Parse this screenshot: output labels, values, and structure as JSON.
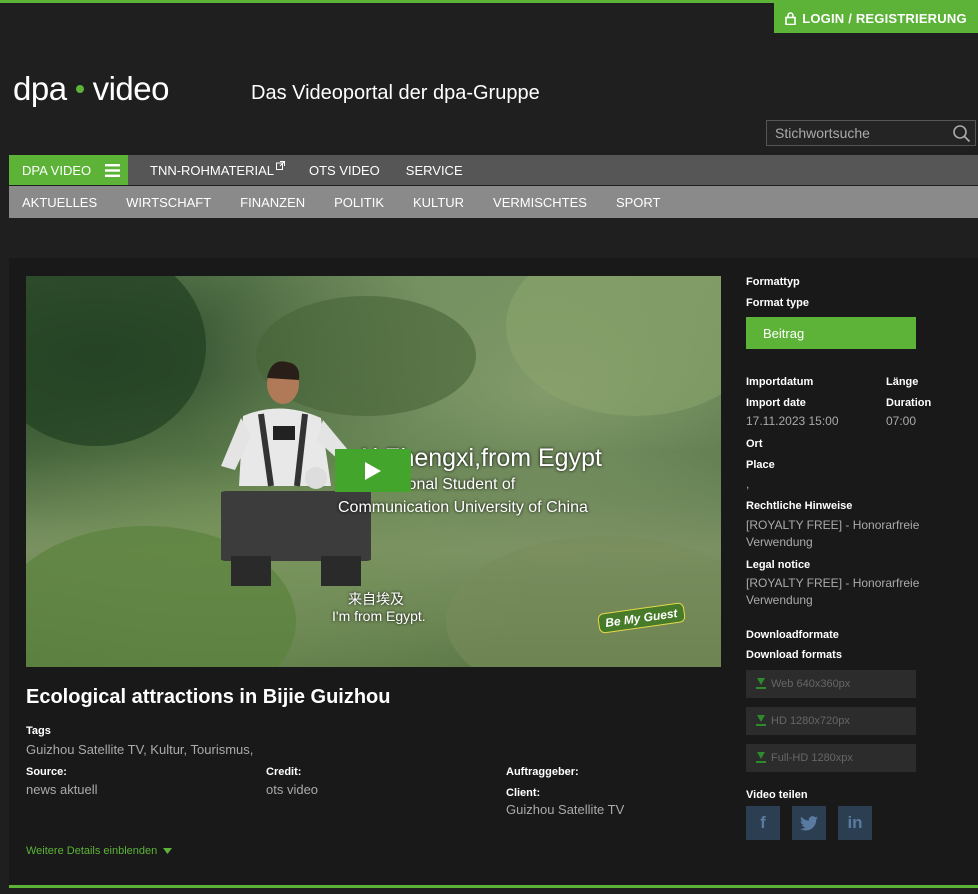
{
  "header": {
    "login_label": "LOGIN / REGISTRIERUNG",
    "logo_left": "dpa",
    "logo_right": "video",
    "tagline": "Das Videoportal der dpa-Gruppe",
    "search_placeholder": "Stichwortsuche"
  },
  "nav_primary": {
    "active": "DPA VIDEO",
    "items": [
      "TNN-ROHMATERIAL",
      "OTS VIDEO",
      "SERVICE"
    ]
  },
  "nav_secondary": [
    "AKTUELLES",
    "WIRTSCHAFT",
    "FINANZEN",
    "POLITIK",
    "KULTUR",
    "VERMISCHTES",
    "SPORT"
  ],
  "video": {
    "caption_line1": "Ai Zhengxi,from Egypt",
    "caption_line2": "ional Student of",
    "caption_line3": "Communication University of China",
    "subtitle_zh": "来自埃及",
    "subtitle_en": "I'm from Egypt.",
    "watermark": "Be My Guest"
  },
  "article": {
    "title": "Ecological attractions in Bijie Guizhou",
    "tags_label": "Tags",
    "tags_value": "Guizhou Satellite TV, Kultur, Tourismus,",
    "source_label": "Source:",
    "source_value": "news aktuell",
    "credit_label": "Credit:",
    "credit_value": "ots video",
    "client_de_label": "Auftraggeber:",
    "client_label": "Client:",
    "client_value": "Guizhou Satellite TV",
    "more_details": "Weitere Details einblenden"
  },
  "sidebar": {
    "format_de": "Formattyp",
    "format_en": "Format type",
    "format_value": "Beitrag",
    "import_de": "Importdatum",
    "import_en": "Import date",
    "import_value": "17.11.2023 15:00",
    "length_de": "Länge",
    "length_en": "Duration",
    "length_value": "07:00",
    "place_de": "Ort",
    "place_en": "Place",
    "place_value": ",",
    "legal_de": "Rechtliche Hinweise",
    "legal_de_value": "[ROYALTY FREE] - Honorarfreie Verwendung",
    "legal_en": "Legal notice",
    "legal_en_value": "[ROYALTY FREE] - Honorarfreie Verwendung",
    "dl_de": "Downloadformate",
    "dl_en": "Download formats",
    "downloads": [
      "Web 640x360px",
      "HD 1280x720px",
      "Full-HD 1280xpx"
    ],
    "share_label": "Video teilen",
    "share": {
      "facebook": "f",
      "linkedin": "in"
    }
  },
  "colors": {
    "accent": "#5cb338",
    "background": "#1f1f1f"
  }
}
